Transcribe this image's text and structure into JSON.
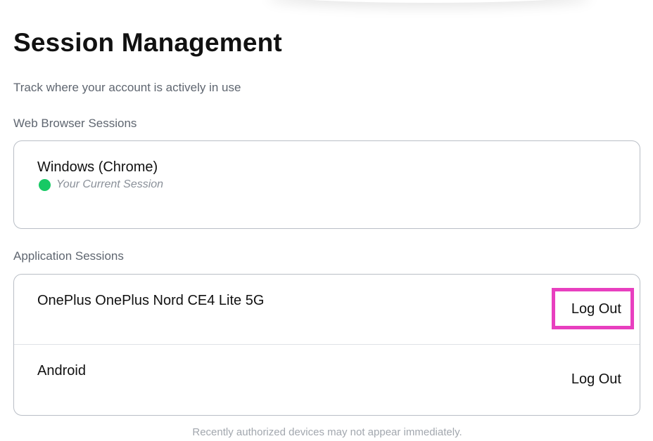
{
  "header": {
    "title": "Session Management",
    "subtitle": "Track where your account is actively in use"
  },
  "web_sessions": {
    "label": "Web Browser Sessions",
    "items": [
      {
        "device": "Windows (Chrome)",
        "status": "Your Current Session",
        "status_color": "#17c964"
      }
    ]
  },
  "app_sessions": {
    "label": "Application Sessions",
    "items": [
      {
        "device": "OnePlus OnePlus Nord CE4 Lite 5G",
        "action": "Log Out"
      },
      {
        "device": "Android",
        "action": "Log Out"
      }
    ]
  },
  "footer": {
    "note": "Recently authorized devices may not appear immediately."
  },
  "highlight": {
    "target": "app_sessions.items.0.action",
    "color": "#e83fbf"
  }
}
